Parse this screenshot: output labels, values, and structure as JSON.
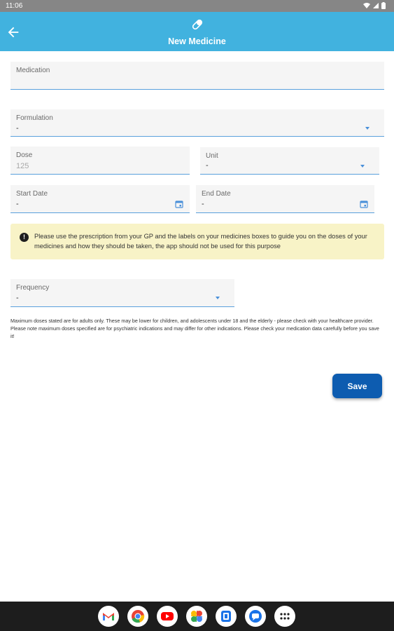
{
  "status_bar": {
    "time": "11:06"
  },
  "app_bar": {
    "title": "New Medicine"
  },
  "form": {
    "medication": {
      "label": "Medication",
      "value": ""
    },
    "formulation": {
      "label": "Formulation",
      "value": "-"
    },
    "dose": {
      "label": "Dose",
      "placeholder": "125"
    },
    "unit": {
      "label": "Unit",
      "value": "-"
    },
    "start_date": {
      "label": "Start Date",
      "value": "-"
    },
    "end_date": {
      "label": "End Date",
      "value": "-"
    },
    "frequency": {
      "label": "Frequency",
      "value": "-"
    }
  },
  "notice": {
    "text": "Please use the prescription from your GP and the labels on your medicines boxes to guide you on the doses of your medicines and how they should be taken, the app should not be used for this purpose"
  },
  "disclaimer": "Maximum doses stated are for adults only. These may be lower for children, and adolescents under 18 and the elderly - please check with your healthcare provider. Please note maximum doses specified are for psychiatric indications and may differ for other indications. Please check your medication data carefully before you save it!",
  "actions": {
    "save_label": "Save"
  },
  "dock": {
    "apps": [
      "gmail-icon",
      "chrome-icon",
      "youtube-icon",
      "photos-icon",
      "app-icon",
      "messages-icon",
      "app-drawer-icon"
    ]
  },
  "colors": {
    "accent": "#41b2df",
    "save_button": "#0d5cb0",
    "notice_bg": "#f8f3c7",
    "field_underline": "#5aa0dc"
  }
}
